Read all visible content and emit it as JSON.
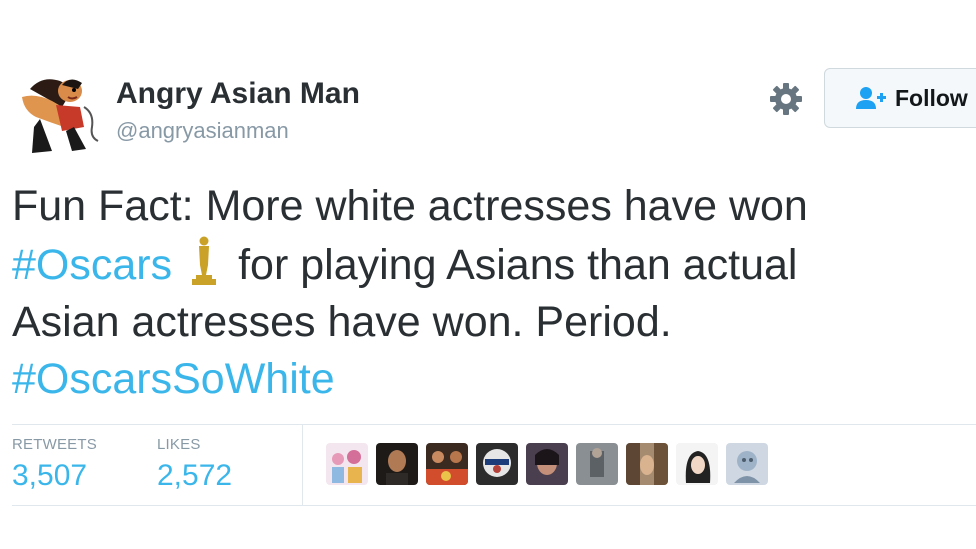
{
  "author": {
    "name": "Angry Asian Man",
    "handle": "@angryasianman"
  },
  "actions": {
    "settings_icon": "gear-icon",
    "follow_label": "Follow",
    "follow_icon": "user-plus-icon"
  },
  "tweet": {
    "line1": "Fun Fact: More white actresses have won",
    "hashtag1": "#Oscars",
    "line2_rest": "for playing Asians than actual",
    "line3": "Asian actresses have won. Period.",
    "hashtag2": "#OscarsSoWhite",
    "emoji_icon": "oscar-statue-icon"
  },
  "stats": {
    "retweets_label": "RETWEETS",
    "retweets_value": "3,507",
    "likes_label": "LIKES",
    "likes_value": "2,572"
  },
  "likers": {
    "count_shown": 9
  },
  "colors": {
    "text": "#292f33",
    "handle": "#8899a6",
    "link": "#3bb6ea",
    "divider": "#e1e8ed",
    "oscar_gold": "#c9a227"
  }
}
